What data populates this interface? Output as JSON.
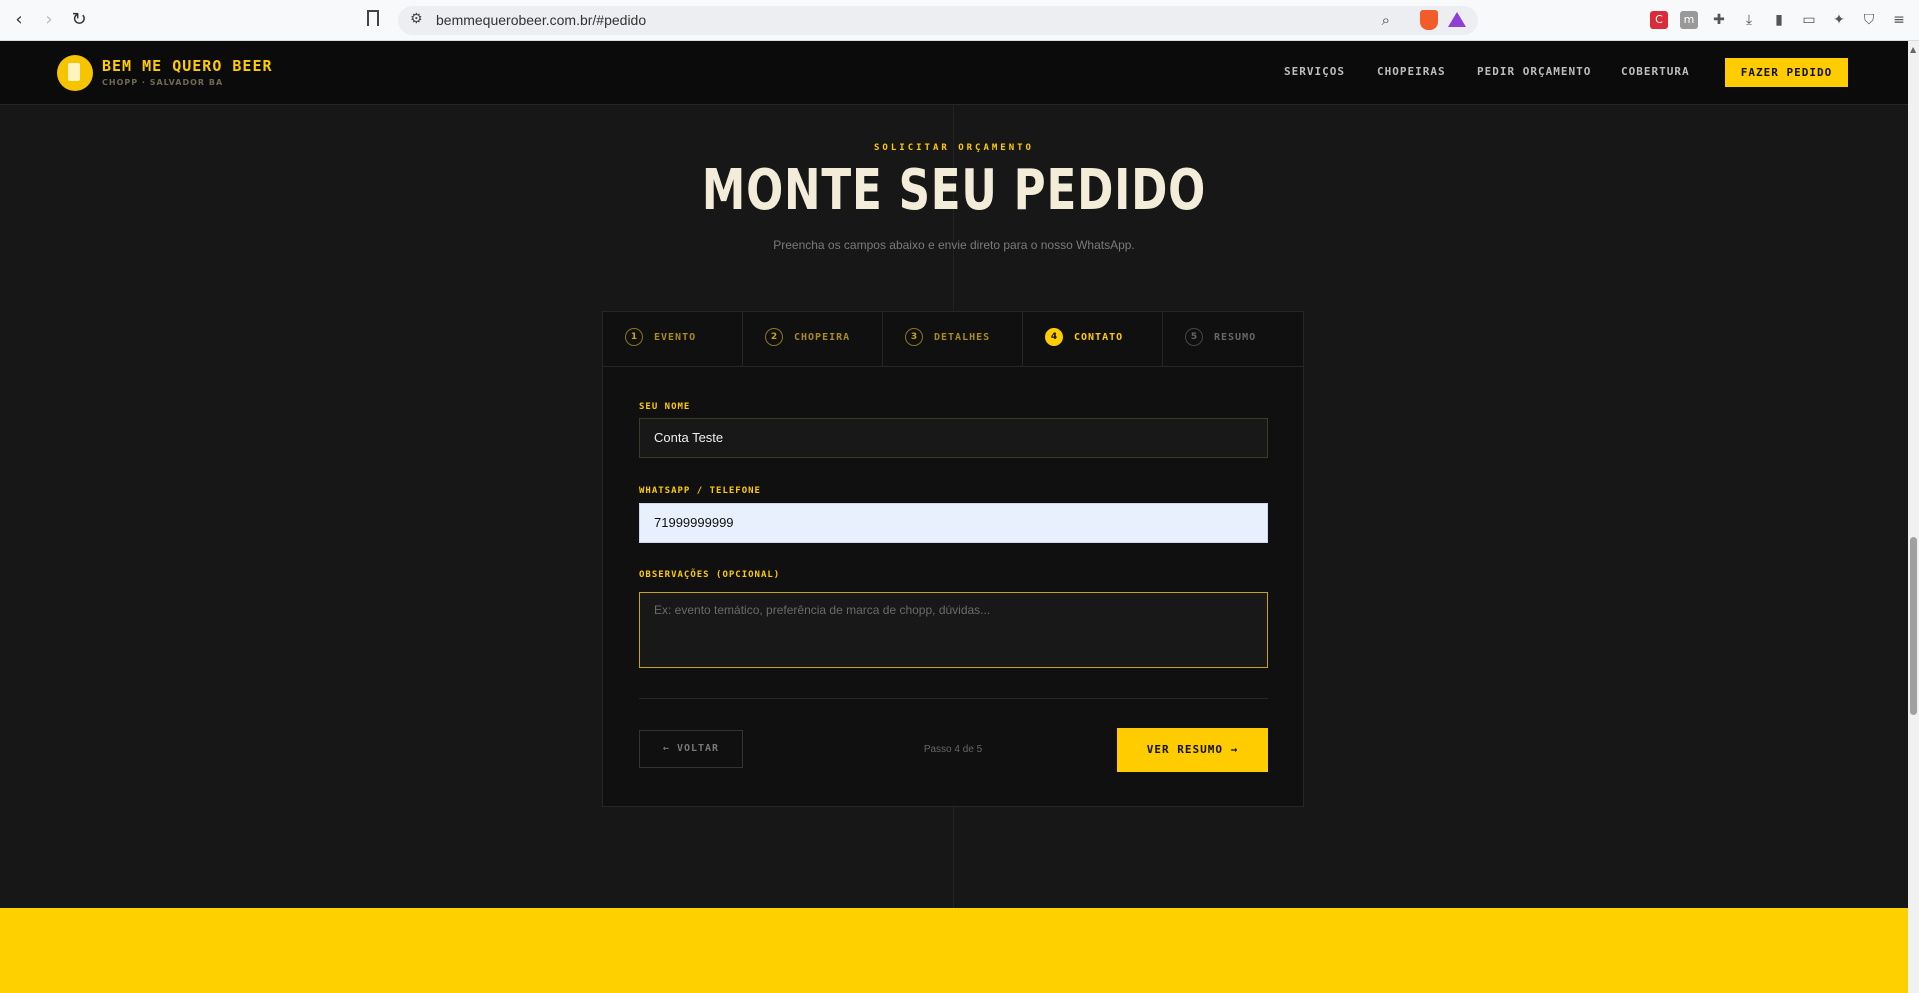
{
  "browser": {
    "url": "bemmequerobeer.com.br/#pedido",
    "back_icon": "‹",
    "forward_icon": "›",
    "reload_icon": "↻"
  },
  "header": {
    "brand": "BEM ME QUERO BEER",
    "brand_sub": "CHOPP · SALVADOR BA",
    "nav": [
      "SERVIÇOS",
      "CHOPEIRAS",
      "PEDIR ORÇAMENTO",
      "COBERTURA"
    ],
    "cta": "FAZER PEDIDO"
  },
  "section": {
    "eyebrow": "SOLICITAR ORÇAMENTO",
    "title": "MONTE SEU PEDIDO",
    "subtitle": "Preencha os campos abaixo e envie direto para o nosso WhatsApp."
  },
  "steps": [
    {
      "num": "1",
      "label": "EVENTO",
      "state": "done"
    },
    {
      "num": "2",
      "label": "CHOPEIRA",
      "state": "done"
    },
    {
      "num": "3",
      "label": "DETALHES",
      "state": "done"
    },
    {
      "num": "4",
      "label": "CONTATO",
      "state": "active"
    },
    {
      "num": "5",
      "label": "RESUMO",
      "state": "future"
    }
  ],
  "form": {
    "name_label": "SEU NOME",
    "name_value": "Conta Teste",
    "phone_label": "WHATSAPP / TELEFONE",
    "phone_value": "71999999999",
    "notes_label": "OBSERVAÇÕES (OPCIONAL)",
    "notes_placeholder": "Ex: evento temático, preferência de marca de chopp, dúvidas..."
  },
  "footer_nav": {
    "back": "← VOLTAR",
    "step_count": "Passo 4 de 5",
    "next": "VER RESUMO →"
  },
  "colors": {
    "accent": "#ffcc00",
    "background": "#171717",
    "card": "#101010"
  }
}
